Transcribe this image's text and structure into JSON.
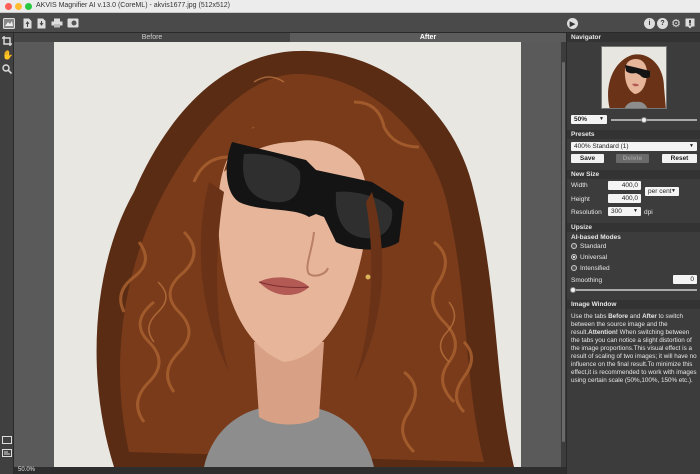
{
  "window": {
    "title": "AKVIS Magnifier AI v.13.0 (CoreML) - akvis1677.jpg (512x512)"
  },
  "toolbar": {
    "icons": [
      "home-icon",
      "open-file-icon",
      "save-file-icon",
      "print-icon",
      "batch-icon",
      "run-icon",
      "info-icon",
      "help-icon",
      "settings-icon",
      "notify-icon"
    ]
  },
  "tabs": {
    "before": "Before",
    "after": "After"
  },
  "status": {
    "zoom": "50.0%"
  },
  "navigator": {
    "title": "Navigator",
    "zoom": "50%"
  },
  "presets": {
    "title": "Presets",
    "selected": "400% Standard (1)",
    "save": "Save",
    "delete": "Delete",
    "reset": "Reset"
  },
  "newsize": {
    "title": "New Size",
    "width_label": "Width",
    "width_value": "400,0",
    "height_label": "Height",
    "height_value": "400,0",
    "unit": "per cent",
    "resolution_label": "Resolution",
    "resolution_value": "300",
    "resolution_unit": "dpi"
  },
  "upsize": {
    "title": "Upsize",
    "modes_title": "AI-based Modes",
    "modes": [
      "Standard",
      "Universal",
      "Intensified"
    ],
    "selected_mode": "Universal",
    "smoothing_label": "Smoothing",
    "smoothing_value": "0"
  },
  "imagewindow": {
    "title": "Image Window",
    "help_1": "Use the tabs ",
    "help_before": "Before",
    "help_2": " and ",
    "help_after": "After",
    "help_3": " to switch between the source image and the result.",
    "help_attention": "Attention!",
    "help_4": " When switching between the tabs you can notice a slight distortion of the image proportions.This visual effect is a result of scaling of two images; it will have no influence on the final result.To minimize this effect,it is recommended to work with images using certain scale (50%,100%, 150% etc.)."
  }
}
